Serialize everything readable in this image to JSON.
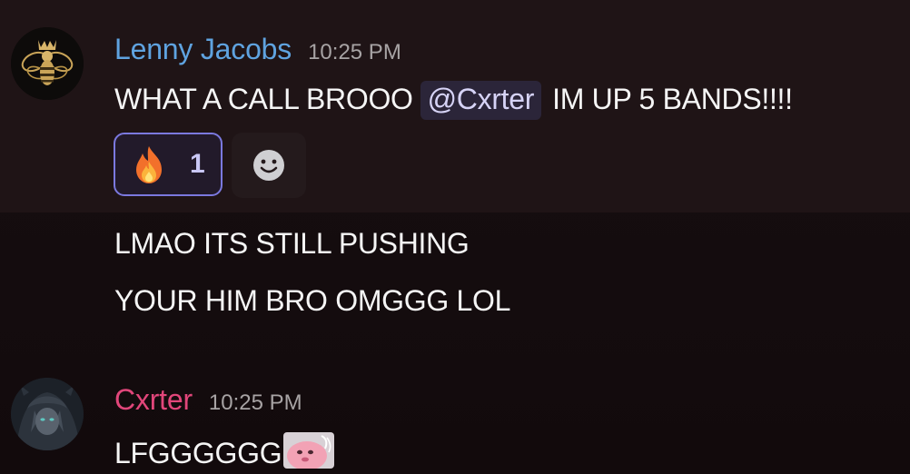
{
  "messages": [
    {
      "author": "Lenny Jacobs",
      "timestamp": "10:25 PM",
      "lines": [
        {
          "before": "WHAT A CALL BROOO",
          "mention": "@Cxrter",
          "after": "IM UP 5 BANDS!!!!"
        }
      ],
      "reactions": [
        {
          "emoji": "fire-emoji",
          "count": "1",
          "selected": true
        }
      ],
      "add_reaction_icon": "smiley-add-reaction-icon",
      "avatar_icon": "crowned-bee-avatar"
    },
    {
      "continuation": true,
      "lines": [
        "LMAO ITS STILL PUSHING",
        "YOUR HIM BRO OMGGG LOL"
      ]
    },
    {
      "author": "Cxrter",
      "timestamp": "10:25 PM",
      "text": "LFGGGGGG",
      "sticker": "pink-blob-emoji",
      "avatar_icon": "dark-anime-avatar"
    }
  ],
  "colors": {
    "background": "#150d0f",
    "lenny_name": "#5fa3e0",
    "cxrter_name": "#e1467a",
    "mention_bg": "#2b2539",
    "reaction_border": "#7b79df"
  }
}
